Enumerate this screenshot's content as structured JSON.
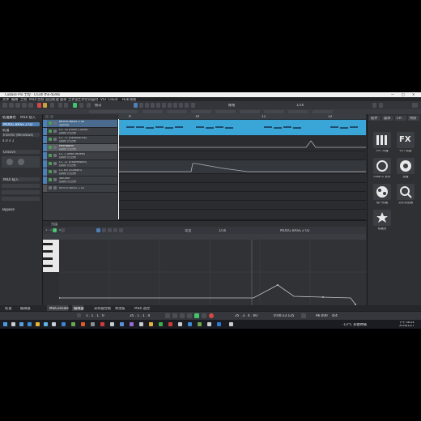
{
  "window": {
    "title": "Cubase Pro 工程 - Crush the dumb",
    "controls": [
      "—",
      "□",
      "✕"
    ]
  },
  "menu": [
    "文件",
    "编辑",
    "工程",
    "MIDI",
    "音频",
    "返回轨道",
    "媒体",
    "工作室",
    "工作空间",
    "窗口",
    "VST Cloud",
    "Hub",
    "帮助"
  ],
  "toolbar": {
    "mode_label": "拖动",
    "grid_label": "1/16",
    "snap_label": "栅格",
    "quantize_label": "1/16"
  },
  "inspector": {
    "tabs": [
      "轨道属性",
      "MIDI 插入"
    ],
    "track_name": "MOOG BASS 2 02",
    "rows": [
      "轨道",
      "Inserts (Windows)",
      "4.0 x 1",
      "Groove",
      "MIDI 插入",
      "Bypass"
    ],
    "footer": "Bypass"
  },
  "tracks": [
    {
      "name": "MOOG BASS 2 02",
      "sub": "全部内容"
    },
    {
      "name": "CC 74 (Filter Cutoff)",
      "sub": "自动化 (已记录)"
    },
    {
      "name": "CC 71 (Resonance)",
      "sub": "自动化 (已记录)"
    },
    {
      "name": "Pitchbend",
      "sub": "自动化 (已记录)"
    },
    {
      "name": "CC 1 (Mod Wheel)",
      "sub": "自动化 (已记录)"
    },
    {
      "name": "CC 11 (Expression)",
      "sub": "自动化 (已记录)"
    },
    {
      "name": "CC 64 (Sustain)",
      "sub": "自动化 (已记录)"
    },
    {
      "name": "Volume",
      "sub": "自动化 (已记录)"
    },
    {
      "name": "MOOG BASS 2 02",
      "sub": ""
    }
  ],
  "ruler_marks": [
    "9",
    "10",
    "11",
    "12"
  ],
  "editor": {
    "title": "MOOG BASS 2 02",
    "grid_label": "1/16",
    "position": "1 . 1 . 1 . 0",
    "controller_label": "弯音",
    "velocity_label": "力度"
  },
  "right_zone": {
    "tabs": [
      "插件",
      "媒体",
      "CR",
      "快照"
    ],
    "tiles": [
      {
        "label": "VST 乐器",
        "icon": "piano-icon"
      },
      {
        "label": "VST 效果",
        "icon": "fx-icon"
      },
      {
        "label": "Loop & 采样",
        "icon": "loop-icon"
      },
      {
        "label": "预置",
        "icon": "preset-icon"
      },
      {
        "label": "用户预置",
        "icon": "user-preset-icon"
      },
      {
        "label": "文件浏览器",
        "icon": "browser-icon"
      },
      {
        "label": "收藏夹",
        "icon": "star-icon"
      }
    ]
  },
  "bottom_tabs": [
    "轨道",
    "编辑器",
    "MixConsole",
    "编辑器",
    "采样器控制",
    "和弦板",
    "MIDI 遥控"
  ],
  "transport": {
    "left_locator": "1 . 1 . 1 . 0",
    "right_locator": "35 . 1 . 1 . 0",
    "position": "35 . 3 . 4 . 60",
    "time": "0:00:23.125",
    "tempo": "96.000",
    "signature": "4/4"
  },
  "taskbar": {
    "weather": "-13°C 多雲時晴",
    "time": "下午 08:24",
    "date": "2024/1/27"
  },
  "colors": {
    "accent_blue": "#3aa6d8",
    "track_green": "#4f9d54",
    "play_green": "#3fc36b",
    "record_red": "#d64848"
  }
}
